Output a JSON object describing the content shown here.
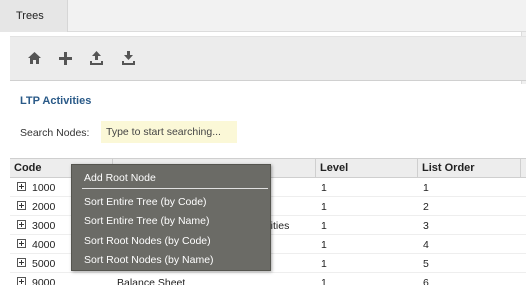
{
  "tabs": [
    {
      "label": "Trees"
    }
  ],
  "toolbar": {
    "buttons": [
      {
        "icon": "home-icon"
      },
      {
        "icon": "add-icon"
      },
      {
        "icon": "upload-icon"
      },
      {
        "icon": "download-icon"
      }
    ]
  },
  "panel": {
    "title": "LTP Activities",
    "search": {
      "label": "Search Nodes:",
      "placeholder": "Type to start searching..."
    }
  },
  "grid": {
    "columns": {
      "code": "Code",
      "name": "",
      "level": "Level",
      "order": "List Order"
    },
    "rows": [
      {
        "code": "1000",
        "name": "",
        "level": "1",
        "order": "1"
      },
      {
        "code": "2000",
        "name": "",
        "level": "1",
        "order": "2"
      },
      {
        "code": "3000",
        "name": "ilities",
        "level": "1",
        "order": "3"
      },
      {
        "code": "4000",
        "name": "",
        "level": "1",
        "order": "4"
      },
      {
        "code": "5000",
        "name": "",
        "level": "1",
        "order": "5"
      },
      {
        "code": "9000",
        "name": "Balance Sheet",
        "level": "1",
        "order": "6"
      }
    ]
  },
  "context_menu": {
    "items": [
      "Add Root Node",
      "Sort Entire Tree (by Code)",
      "Sort Entire Tree (by Name)",
      "Sort Root Nodes (by Code)",
      "Sort Root Nodes (by Name)"
    ]
  },
  "colors": {
    "title": "#2a5a88",
    "search_bg": "#fbf8d7",
    "menu_bg": "#6b6b66",
    "toolbar_icon": "#555555"
  }
}
